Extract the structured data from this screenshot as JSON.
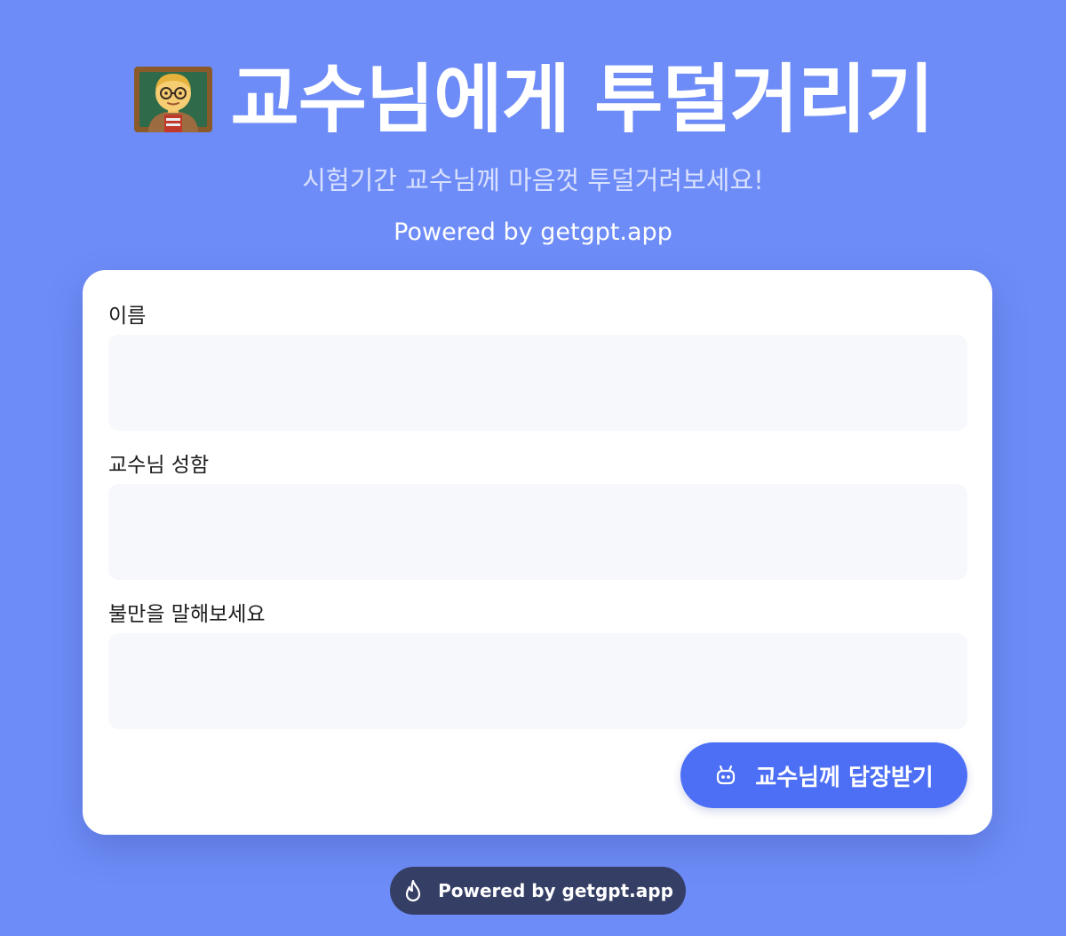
{
  "header": {
    "emoji_icon": "man-teacher-emoji-icon",
    "title": "교수님에게 투덜거리기",
    "subtitle": "시험기간 교수님께 마음껏 투덜거려보세요!",
    "powered_by": "Powered by getgpt.app"
  },
  "form": {
    "fields": [
      {
        "label": "이름",
        "value": "",
        "placeholder": ""
      },
      {
        "label": "교수님 성함",
        "value": "",
        "placeholder": ""
      },
      {
        "label": "불만을 말해보세요",
        "value": "",
        "placeholder": ""
      }
    ],
    "submit": {
      "icon": "robot-icon",
      "label": "교수님께 답장받기"
    }
  },
  "footer": {
    "icon": "flame-icon",
    "label": "Powered by getgpt.app"
  },
  "colors": {
    "background": "#6e8cf7",
    "card": "#ffffff",
    "input_bg": "#f7f8fc",
    "button": "#4d6ff5",
    "footer_badge": "#353e65"
  }
}
